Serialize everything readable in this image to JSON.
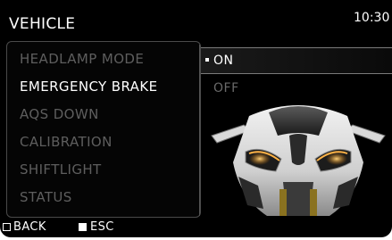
{
  "header": {
    "title": "VEHICLE",
    "clock": "10:30"
  },
  "menu": {
    "items": [
      {
        "label": "HEADLAMP MODE",
        "active": false
      },
      {
        "label": "EMERGENCY BRAKE",
        "active": true
      },
      {
        "label": "AQS DOWN",
        "active": false
      },
      {
        "label": "CALIBRATION",
        "active": false
      },
      {
        "label": "SHIFTLIGHT",
        "active": false
      },
      {
        "label": "STATUS",
        "active": false
      }
    ]
  },
  "options": {
    "selected": "ON",
    "other": "OFF"
  },
  "footer": {
    "back_label": "BACK",
    "esc_label": "ESC",
    "back_icon": "outline-square-icon",
    "esc_icon": "filled-square-icon"
  },
  "colors": {
    "background": "#000000",
    "active_text": "#ffffff",
    "inactive_text": "#5e5e5e"
  }
}
